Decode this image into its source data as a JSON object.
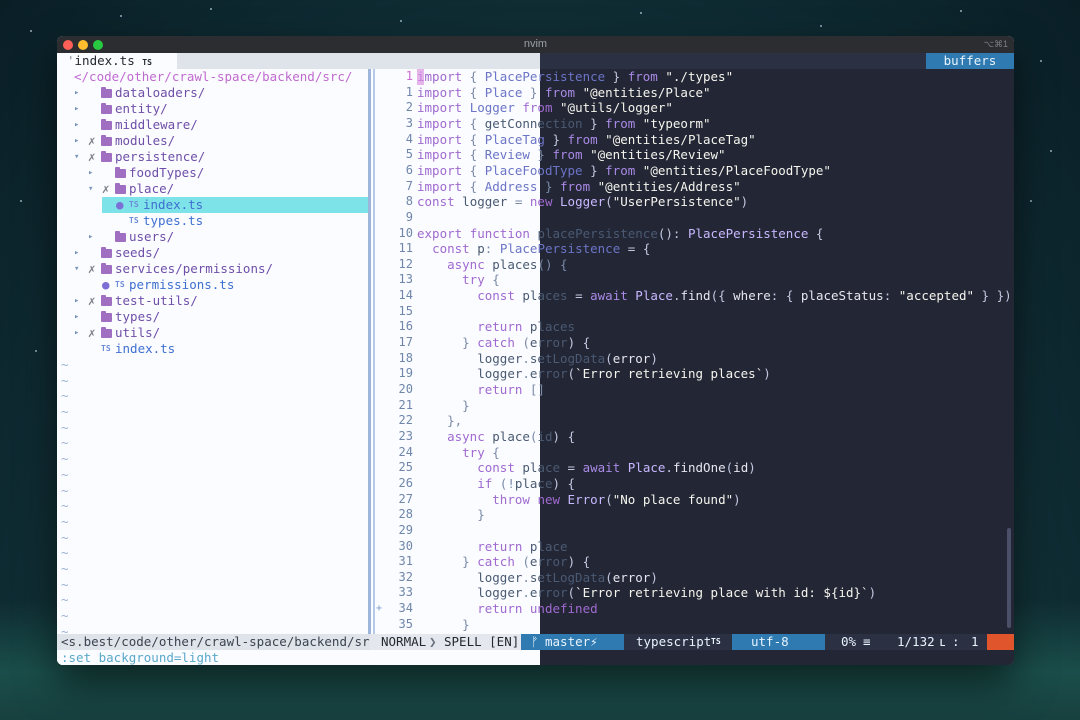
{
  "window": {
    "title": "nvim",
    "shortcut": "⌥⌘1"
  },
  "tabline": {
    "active_tab": "index.ts",
    "modified_mark": "'",
    "ts_badge": "TS",
    "right_label": "buffers"
  },
  "tree": {
    "root": "</code/other/crawl-space/backend/src/",
    "items": [
      {
        "indent": 0,
        "caret": "▸",
        "git": "",
        "kind": "folder",
        "label": "dataloaders/"
      },
      {
        "indent": 0,
        "caret": "▸",
        "git": "",
        "kind": "folder",
        "label": "entity/"
      },
      {
        "indent": 0,
        "caret": "▸",
        "git": "",
        "kind": "folder",
        "label": "middleware/"
      },
      {
        "indent": 0,
        "caret": "▸",
        "git": "✗",
        "kind": "folder",
        "label": "modules/"
      },
      {
        "indent": 0,
        "caret": "▾",
        "git": "✗",
        "kind": "folder",
        "label": "persistence/"
      },
      {
        "indent": 1,
        "caret": "▸",
        "git": "",
        "kind": "folder",
        "label": "foodTypes/"
      },
      {
        "indent": 1,
        "caret": "▾",
        "git": "✗",
        "kind": "folder",
        "label": "place/"
      },
      {
        "indent": 2,
        "caret": "",
        "git": "●",
        "kind": "file",
        "label": "index.ts",
        "selected": true
      },
      {
        "indent": 2,
        "caret": "",
        "git": "",
        "kind": "file",
        "label": "types.ts"
      },
      {
        "indent": 1,
        "caret": "▸",
        "git": "",
        "kind": "folder",
        "label": "users/"
      },
      {
        "indent": 0,
        "caret": "▸",
        "git": "",
        "kind": "folder",
        "label": "seeds/"
      },
      {
        "indent": 0,
        "caret": "▾",
        "git": "✗",
        "kind": "folder",
        "label": "services/permissions/"
      },
      {
        "indent": 1,
        "caret": "",
        "git": "●",
        "kind": "file",
        "label": "permissions.ts"
      },
      {
        "indent": 0,
        "caret": "▸",
        "git": "✗",
        "kind": "folder",
        "label": "test-utils/"
      },
      {
        "indent": 0,
        "caret": "▸",
        "git": "",
        "kind": "folder",
        "label": "types/"
      },
      {
        "indent": 0,
        "caret": "▸",
        "git": "✗",
        "kind": "folder",
        "label": "utils/"
      },
      {
        "indent": 0,
        "caret": "",
        "git": "",
        "kind": "file",
        "label": "index.ts"
      }
    ],
    "tilde": "~",
    "path": "<s.best/code/other/crawl-space/backend/src"
  },
  "editor": {
    "lines": [
      {
        "n": "1",
        "t": "import { PlacePersistence } from \"./types\""
      },
      {
        "n": "1",
        "t": "import { Place } from \"@entities/Place\""
      },
      {
        "n": "2",
        "t": "import Logger from \"@utils/logger\""
      },
      {
        "n": "3",
        "t": "import { getConnection } from \"typeorm\""
      },
      {
        "n": "4",
        "t": "import { PlaceTag } from \"@entities/PlaceTag\""
      },
      {
        "n": "5",
        "t": "import { Review } from \"@entities/Review\""
      },
      {
        "n": "6",
        "t": "import { PlaceFoodType } from \"@entities/PlaceFoodType\""
      },
      {
        "n": "7",
        "t": "import { Address } from \"@entities/Address\""
      },
      {
        "n": "8",
        "t": "const logger = new Logger(\"UserPersistence\")"
      },
      {
        "n": "9",
        "t": ""
      },
      {
        "n": "10",
        "t": "export function placePersistence(): PlacePersistence {"
      },
      {
        "n": "11",
        "t": "  const p: PlacePersistence = {"
      },
      {
        "n": "12",
        "t": "    async places() {"
      },
      {
        "n": "13",
        "t": "      try {"
      },
      {
        "n": "14",
        "t": "        const places = await Place.find({ where: { placeStatus: \"accepted\" } })"
      },
      {
        "n": "15",
        "t": ""
      },
      {
        "n": "16",
        "t": "        return places"
      },
      {
        "n": "17",
        "t": "      } catch (error) {"
      },
      {
        "n": "18",
        "t": "        logger.setLogData(error)"
      },
      {
        "n": "19",
        "t": "        logger.error(`Error retrieving places`)"
      },
      {
        "n": "20",
        "t": "        return []"
      },
      {
        "n": "21",
        "t": "      }"
      },
      {
        "n": "22",
        "t": "    },"
      },
      {
        "n": "23",
        "t": "    async place(id) {"
      },
      {
        "n": "24",
        "t": "      try {"
      },
      {
        "n": "25",
        "t": "        const place = await Place.findOne(id)"
      },
      {
        "n": "26",
        "t": "        if (!place) {"
      },
      {
        "n": "27",
        "t": "          throw new Error(\"No place found\")"
      },
      {
        "n": "28",
        "t": "        }"
      },
      {
        "n": "29",
        "t": ""
      },
      {
        "n": "30",
        "t": "        return place"
      },
      {
        "n": "31",
        "t": "      } catch (error) {"
      },
      {
        "n": "32",
        "t": "        logger.setLogData(error)"
      },
      {
        "n": "33",
        "t": "        logger.error(`Error retrieving place with id: ${id}`)"
      },
      {
        "n": "34",
        "t": "        return undefined",
        "sign": "+"
      },
      {
        "n": "35",
        "t": "      }"
      }
    ]
  },
  "status": {
    "mode": "NORMAL",
    "spell": "SPELL [EN]",
    "branch_icon": "ᚠ",
    "branch": "master⚡",
    "filetype": "typescript",
    "ft_badge": "TS",
    "encoding": "utf-8",
    "percent": "0%",
    "percent_icon": "≡",
    "position": "1/132",
    "col": "1",
    "col_sep": ":",
    "ln_icon": "ʟ"
  },
  "cmdline": {
    "text": ":set background=light"
  },
  "colors": {
    "light_bg": "#fafcff",
    "dark_bg": "#232635",
    "selection": "#7de3e8",
    "accent_blue": "#2f7ab0",
    "keyword": "#b072d4",
    "string_dark": "#f8f8f2",
    "error_red": "#e0552c"
  }
}
